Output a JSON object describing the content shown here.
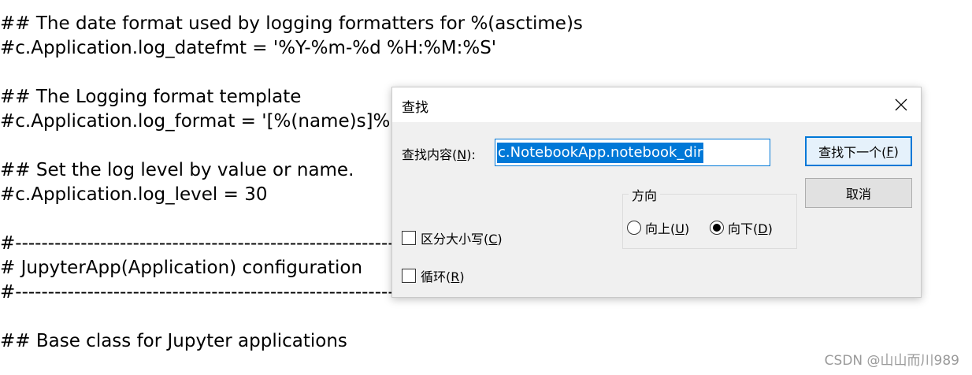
{
  "editor": {
    "lines": [
      "## The date format used by logging formatters for %(asctime)s",
      "#c.Application.log_datefmt = '%Y-%m-%d %H:%M:%S'",
      "## The Logging format template",
      "#c.Application.log_format = '[%(name)s]%(h",
      "## Set the log level by value or name.",
      "#c.Application.log_level = 30",
      "#------------------------------------------------------------------------------",
      "# JupyterApp(Application) configuration",
      "#------------------------------------------------------------------------------",
      "## Base class for Jupyter applications"
    ]
  },
  "watermark": "CSDN @山山而川989",
  "dialog": {
    "title": "查找",
    "find_label_prefix": "查找内容(",
    "find_label_hotkey": "N",
    "find_label_suffix": "):",
    "find_value": "c.NotebookApp.notebook_dir",
    "find_next_prefix": "查找下一个(",
    "find_next_hotkey": "F",
    "find_next_suffix": ")",
    "cancel_label": "取消",
    "direction_label": "方向",
    "up_prefix": "向上(",
    "up_hotkey": "U",
    "up_suffix": ")",
    "down_prefix": "向下(",
    "down_hotkey": "D",
    "down_suffix": ")",
    "direction_selected": "down",
    "match_case_prefix": "区分大小写(",
    "match_case_hotkey": "C",
    "match_case_suffix": ")",
    "match_case_checked": false,
    "wrap_prefix": "循环(",
    "wrap_hotkey": "R",
    "wrap_suffix": ")",
    "wrap_checked": false
  },
  "colors": {
    "accent": "#0078d7",
    "dialog_bg": "#f0f0f0"
  }
}
